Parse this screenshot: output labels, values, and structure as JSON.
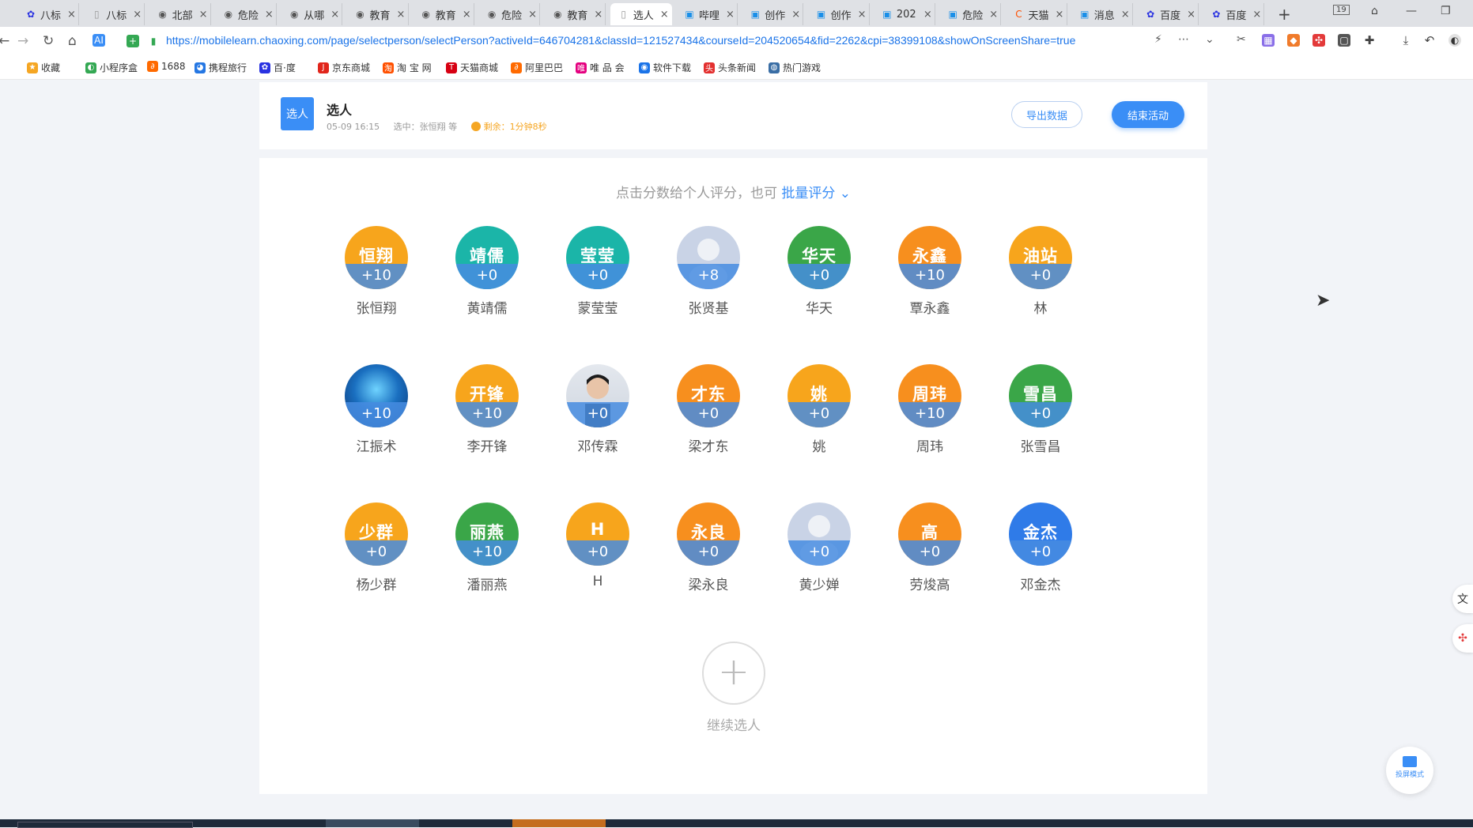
{
  "browser": {
    "tabs": [
      {
        "label": "八标",
        "icon": "paw-icon"
      },
      {
        "label": "八标",
        "icon": "blank-page-icon"
      },
      {
        "label": "北部",
        "icon": "globe-icon"
      },
      {
        "label": "危险",
        "icon": "globe-icon"
      },
      {
        "label": "从哪",
        "icon": "globe-icon"
      },
      {
        "label": "教育",
        "icon": "globe-icon"
      },
      {
        "label": "教育",
        "icon": "globe-icon"
      },
      {
        "label": "危险",
        "icon": "globe-icon"
      },
      {
        "label": "教育",
        "icon": "globe-icon"
      },
      {
        "label": "选人",
        "icon": "blank-page-icon",
        "active": true
      },
      {
        "label": "哔哩",
        "icon": "tv-icon"
      },
      {
        "label": "创作",
        "icon": "tv-icon"
      },
      {
        "label": "创作",
        "icon": "tv-icon"
      },
      {
        "label": "202",
        "icon": "tv-icon"
      },
      {
        "label": "危险",
        "icon": "tv-icon"
      },
      {
        "label": "天猫",
        "icon": "tmall-icon"
      },
      {
        "label": "消息",
        "icon": "tv-icon"
      },
      {
        "label": "百度",
        "icon": "paw-icon"
      },
      {
        "label": "百度",
        "icon": "paw-icon"
      }
    ],
    "new_tab": "+",
    "window_counter": "19",
    "url": "https://mobilelearn.chaoxing.com/page/selectperson/selectPerson?activeId=646704281&classId=121527434&courseId=204520654&fid=2262&cpi=38399108&showOnScreenShare=true",
    "url_domain": "mobilelearn.chaoxing.com",
    "bookmarks": [
      {
        "label": "收藏",
        "color": "#f5a623"
      },
      {
        "label": "小程序盒",
        "color": "#34a853"
      },
      {
        "label": "1688",
        "color": "#ff6a00"
      },
      {
        "label": "携程旅行",
        "color": "#2577e3"
      },
      {
        "label": "百·度",
        "color": "#2932e1"
      },
      {
        "label": "京东商城",
        "color": "#e1251b"
      },
      {
        "label": "淘 宝 网",
        "color": "#ff5000"
      },
      {
        "label": "天猫商城",
        "color": "#d70012"
      },
      {
        "label": "阿里巴巴",
        "color": "#ff6a00"
      },
      {
        "label": "唯 品 会",
        "color": "#e4007f"
      },
      {
        "label": "软件下载",
        "color": "#1a73e8"
      },
      {
        "label": "头条新闻",
        "color": "#e3302f"
      },
      {
        "label": "热门游戏",
        "color": "#3a6ea5"
      }
    ]
  },
  "activity": {
    "icon_label": "选人",
    "title": "选人",
    "date": "05-09 16:15",
    "selected": "选中：张恒翔 等",
    "remaining": "剩余：1分钟8秒",
    "export_label": "导出数据",
    "end_label": "结束活动"
  },
  "main": {
    "hint": "点击分数给个人评分，也可",
    "batch_label": "批量评分",
    "add_label": "继续选人",
    "people": [
      {
        "avatar": "恒翔",
        "score": "+10",
        "name": "张恒翔",
        "color": "#f7a51c"
      },
      {
        "avatar": "靖儒",
        "score": "+0",
        "name": "黄靖儒",
        "color": "#1bb5a8"
      },
      {
        "avatar": "莹莹",
        "score": "+0",
        "name": "蒙莹莹",
        "color": "#1bb5a8"
      },
      {
        "avatar": "",
        "score": "+8",
        "name": "张贤基",
        "color": "#c9d3e6",
        "photo": "default"
      },
      {
        "avatar": "华天",
        "score": "+0",
        "name": "华天",
        "color": "#3aa648"
      },
      {
        "avatar": "永鑫",
        "score": "+10",
        "name": "覃永鑫",
        "color": "#f78f1e"
      },
      {
        "avatar": "油站",
        "score": "+0",
        "name": "林",
        "color": "#f7a51c"
      },
      {
        "avatar": "",
        "score": "+10",
        "name": "江振术",
        "color": "#1e5fa8",
        "photo": "ocean"
      },
      {
        "avatar": "开锋",
        "score": "+10",
        "name": "李开锋",
        "color": "#f7a51c"
      },
      {
        "avatar": "",
        "score": "+0",
        "name": "邓传霖",
        "color": "#d8dde6",
        "photo": "person"
      },
      {
        "avatar": "才东",
        "score": "+0",
        "name": "梁才东",
        "color": "#f78f1e"
      },
      {
        "avatar": "姚",
        "score": "+0",
        "name": "姚",
        "color": "#f7a51c"
      },
      {
        "avatar": "周玮",
        "score": "+10",
        "name": "周玮",
        "color": "#f78f1e"
      },
      {
        "avatar": "雪昌",
        "score": "+0",
        "name": "张雪昌",
        "color": "#3aa648"
      },
      {
        "avatar": "少群",
        "score": "+0",
        "name": "杨少群",
        "color": "#f7a51c"
      },
      {
        "avatar": "丽燕",
        "score": "+10",
        "name": "潘丽燕",
        "color": "#3aa648"
      },
      {
        "avatar": "H",
        "score": "+0",
        "name": "H",
        "color": "#f7a51c"
      },
      {
        "avatar": "永良",
        "score": "+0",
        "name": "梁永良",
        "color": "#f78f1e"
      },
      {
        "avatar": "",
        "score": "+0",
        "name": "黄少婵",
        "color": "#c9d3e6",
        "photo": "default"
      },
      {
        "avatar": "高",
        "score": "+0",
        "name": "劳焌高",
        "color": "#f78f1e"
      },
      {
        "avatar": "金杰",
        "score": "+0",
        "name": "邓金杰",
        "color": "#2f7be8"
      }
    ]
  },
  "float": {
    "project_label": "投屏模式"
  }
}
